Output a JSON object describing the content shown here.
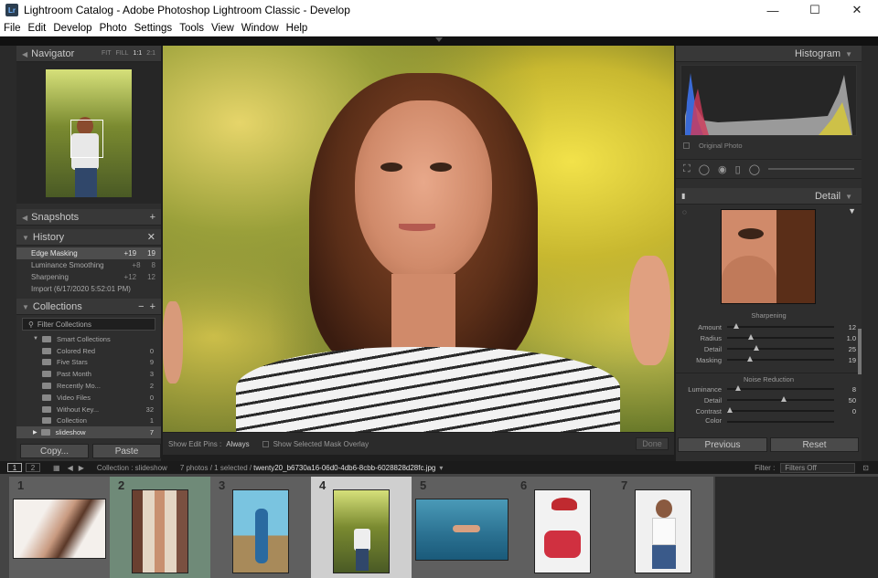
{
  "window": {
    "title": "Lightroom Catalog - Adobe Photoshop Lightroom Classic - Develop",
    "logo": "Lr"
  },
  "menu": [
    "File",
    "Edit",
    "Develop",
    "Photo",
    "Settings",
    "Tools",
    "View",
    "Window",
    "Help"
  ],
  "navigator": {
    "title": "Navigator",
    "options": [
      "FIT",
      "FILL",
      "1:1",
      "2:1"
    ]
  },
  "snapshots": {
    "title": "Snapshots"
  },
  "history": {
    "title": "History",
    "items": [
      {
        "label": "Edge Masking",
        "v1": "+19",
        "v2": "19",
        "selected": true
      },
      {
        "label": "Luminance Smoothing",
        "v1": "+8",
        "v2": "8"
      },
      {
        "label": "Sharpening",
        "v1": "+12",
        "v2": "12"
      },
      {
        "label": "Import (6/17/2020 5:52:01 PM)",
        "v1": "",
        "v2": ""
      }
    ]
  },
  "collections": {
    "title": "Collections",
    "filter": "Filter Collections",
    "group": "Smart Collections",
    "items": [
      {
        "label": "Colored Red",
        "count": "0"
      },
      {
        "label": "Five Stars",
        "count": "9"
      },
      {
        "label": "Past Month",
        "count": "3"
      },
      {
        "label": "Recently Mo...",
        "count": "2"
      },
      {
        "label": "Video Files",
        "count": "0"
      },
      {
        "label": "Without Key...",
        "count": "32"
      },
      {
        "label": "Collection",
        "count": "1"
      },
      {
        "label": "slideshow",
        "count": "7",
        "selected": true
      }
    ]
  },
  "left_buttons": {
    "copy": "Copy...",
    "paste": "Paste"
  },
  "toolbar": {
    "show_pins_label": "Show Edit Pins :",
    "show_pins_value": "Always",
    "mask_overlay": "Show Selected Mask Overlay",
    "done": "Done"
  },
  "histogram": {
    "title": "Histogram",
    "original": "Original Photo"
  },
  "detail": {
    "title": "Detail",
    "sharpening": {
      "title": "Sharpening",
      "rows": [
        {
          "label": "Amount",
          "value": "12",
          "pos": 0.06
        },
        {
          "label": "Radius",
          "value": "1.0",
          "pos": 0.3
        },
        {
          "label": "Detail",
          "value": "25",
          "pos": 0.25
        },
        {
          "label": "Masking",
          "value": "19",
          "pos": 0.19
        }
      ]
    },
    "noise": {
      "title": "Noise Reduction",
      "rows": [
        {
          "label": "Luminance",
          "value": "8",
          "pos": 0.08
        },
        {
          "label": "Detail",
          "value": "50",
          "pos": 0.5
        },
        {
          "label": "Contrast",
          "value": "0",
          "pos": 0.0
        }
      ],
      "partial": "Color"
    }
  },
  "right_buttons": {
    "previous": "Previous",
    "reset": "Reset"
  },
  "status": {
    "screens": [
      "1",
      "2"
    ],
    "source": "Collection : slideshow",
    "count": "7 photos / 1 selected /",
    "filename": "twenty20_b6730a16-06d0-4db6-8cbb-6028828d28fc.jpg",
    "filter_label": "Filter :",
    "filter_value": "Filters Off"
  },
  "filmstrip": [
    "1",
    "2",
    "3",
    "4",
    "5",
    "6",
    "7"
  ]
}
